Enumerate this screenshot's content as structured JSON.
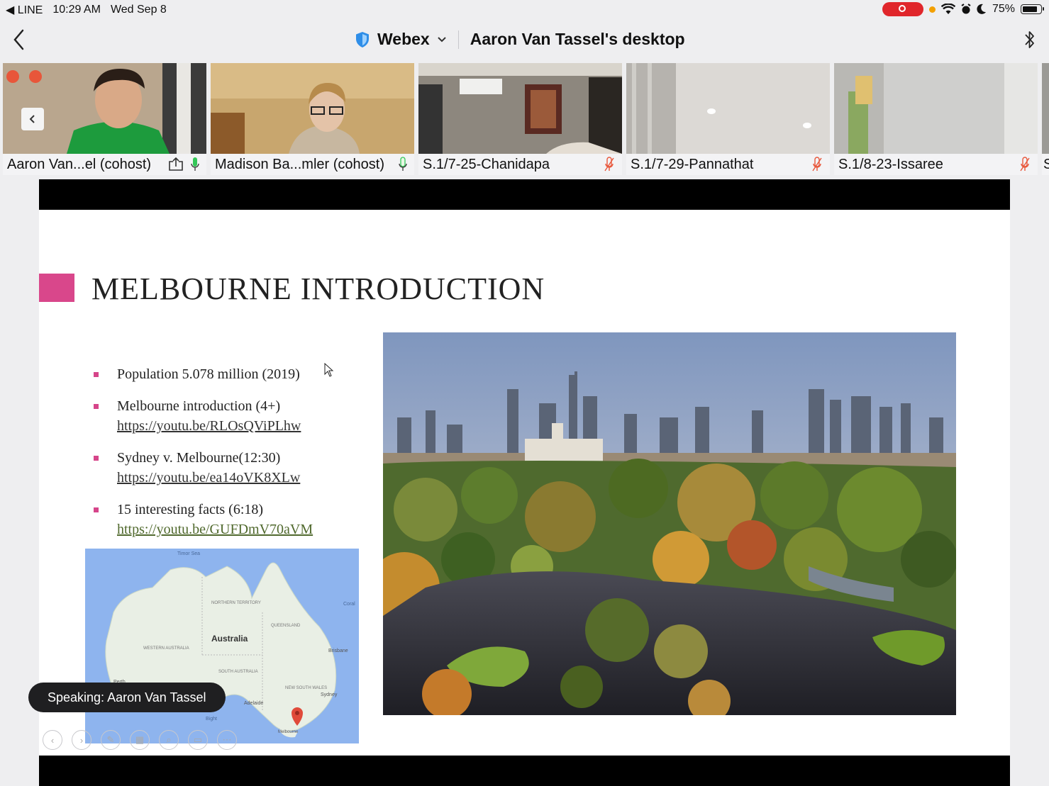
{
  "status_bar": {
    "back_app": "LINE",
    "time": "10:29 AM",
    "date": "Wed Sep 8",
    "battery": "75%",
    "battery_level": 0.75
  },
  "nav": {
    "app_name": "Webex",
    "title": "Aaron Van Tassel's desktop"
  },
  "participants": [
    {
      "name": "Aaron Van...el (cohost)",
      "mic": "on",
      "sharing": true
    },
    {
      "name": "Madison Ba...mler (cohost)",
      "mic": "on",
      "sharing": false
    },
    {
      "name": "S.1/7-25-Chanidapa",
      "mic": "muted",
      "sharing": false
    },
    {
      "name": "S.1/7-29-Pannathat",
      "mic": "muted",
      "sharing": false
    },
    {
      "name": "S.1/8-23-Issaree",
      "mic": "muted",
      "sharing": false
    },
    {
      "name": "S",
      "mic": "",
      "sharing": false
    }
  ],
  "slide": {
    "title": "MELBOURNE INTRODUCTION",
    "accent_color": "#d9478b",
    "bullets": [
      {
        "text": "Population 5.078 million (2019)",
        "link": ""
      },
      {
        "text": "Melbourne introduction (4+)",
        "link": "https://youtu.be/RLOsQViPLhw"
      },
      {
        "text": "Sydney v. Melbourne(12:30)",
        "link": "https://youtu.be/ea14oVK8XLw"
      },
      {
        "text": "15 interesting facts (6:18)",
        "link": "https://youtu.be/GUFDmV70aVM"
      }
    ],
    "map": {
      "country_label": "Australia",
      "region_labels": [
        "Timor Sea",
        "NORTHERN TERRITORY",
        "QUEENSLAND",
        "WESTERN AUSTRALIA",
        "SOUTH AUSTRALIA",
        "NEW SOUTH WALES",
        "Coral",
        "Brisbane",
        "Sydney",
        "Adelaide",
        "Melbourne",
        "Perth",
        "Bight"
      ]
    }
  },
  "speaking": "Speaking: Aaron Van Tassel",
  "colors": {
    "record": "#e0262b",
    "mic_on": "#34c759",
    "mic_muted": "#e8563a",
    "webex_shield": "#2f8ee8"
  }
}
